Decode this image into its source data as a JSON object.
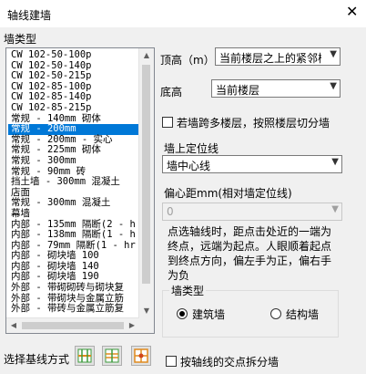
{
  "window": {
    "title": "轴线建墙",
    "close_glyph": "✕"
  },
  "wall_types": {
    "caption": "墙类型",
    "items": [
      "CW 102-50-100p",
      "CW 102-50-140p",
      "CW 102-50-215p",
      "CW 102-85-100p",
      "CW 102-85-140p",
      "CW 102-85-215p",
      "常规 - 140mm 砌体",
      "常规 - 200mm",
      "常规 - 200mm - 实心",
      "常规 - 225mm 砌体",
      "常规 - 300mm",
      "常规 - 90mm 砖",
      "挡土墙 - 300mm 混凝土",
      "店面",
      "常规 - 300mm 混凝土",
      "幕墙",
      "内部 - 135mm 隔断(2 - h",
      "内部 - 138mm 隔断(1 - h",
      "内部 - 79mm 隔断(1 - hr",
      "内部 - 砌块墙 100",
      "内部 - 砌块墙 140",
      "内部 - 砌块墙 190",
      "外部 - 带砌砌砖与砌块复",
      "外部 - 带砌块与金属立筋",
      "外部 - 带砖与金属立筋复"
    ],
    "selected_index": 7
  },
  "form": {
    "top_height_label": "顶高（m）",
    "top_height_value": "当前楼层之上的紧邻楼层",
    "base_height_label": "底高",
    "base_height_value": "当前楼层",
    "split_by_floor_label": "若墙跨多楼层，按照楼层切分墙",
    "split_by_floor_checked": false,
    "locate_label": "墙上定位线",
    "locate_value": "墙中心线",
    "offset_label": "偏心距mm(相对墙定位线)",
    "offset_value": "0",
    "note": "点选轴线时，距点击处近的一端为终点，远端为起点。人眼顺着起点到终点方向，偏左手为正，偏右手为负",
    "wall_category_caption": "墙类型",
    "category_options": [
      "建筑墙",
      "结构墙"
    ],
    "category_selected": 0,
    "baseline_label": "选择基线方式",
    "split_at_intersection_label": "按轴线的交点拆分墙",
    "split_at_intersection_checked": false
  },
  "icons": {
    "grid_colors": [
      "#3c9a3c",
      "#e08a1e"
    ]
  }
}
